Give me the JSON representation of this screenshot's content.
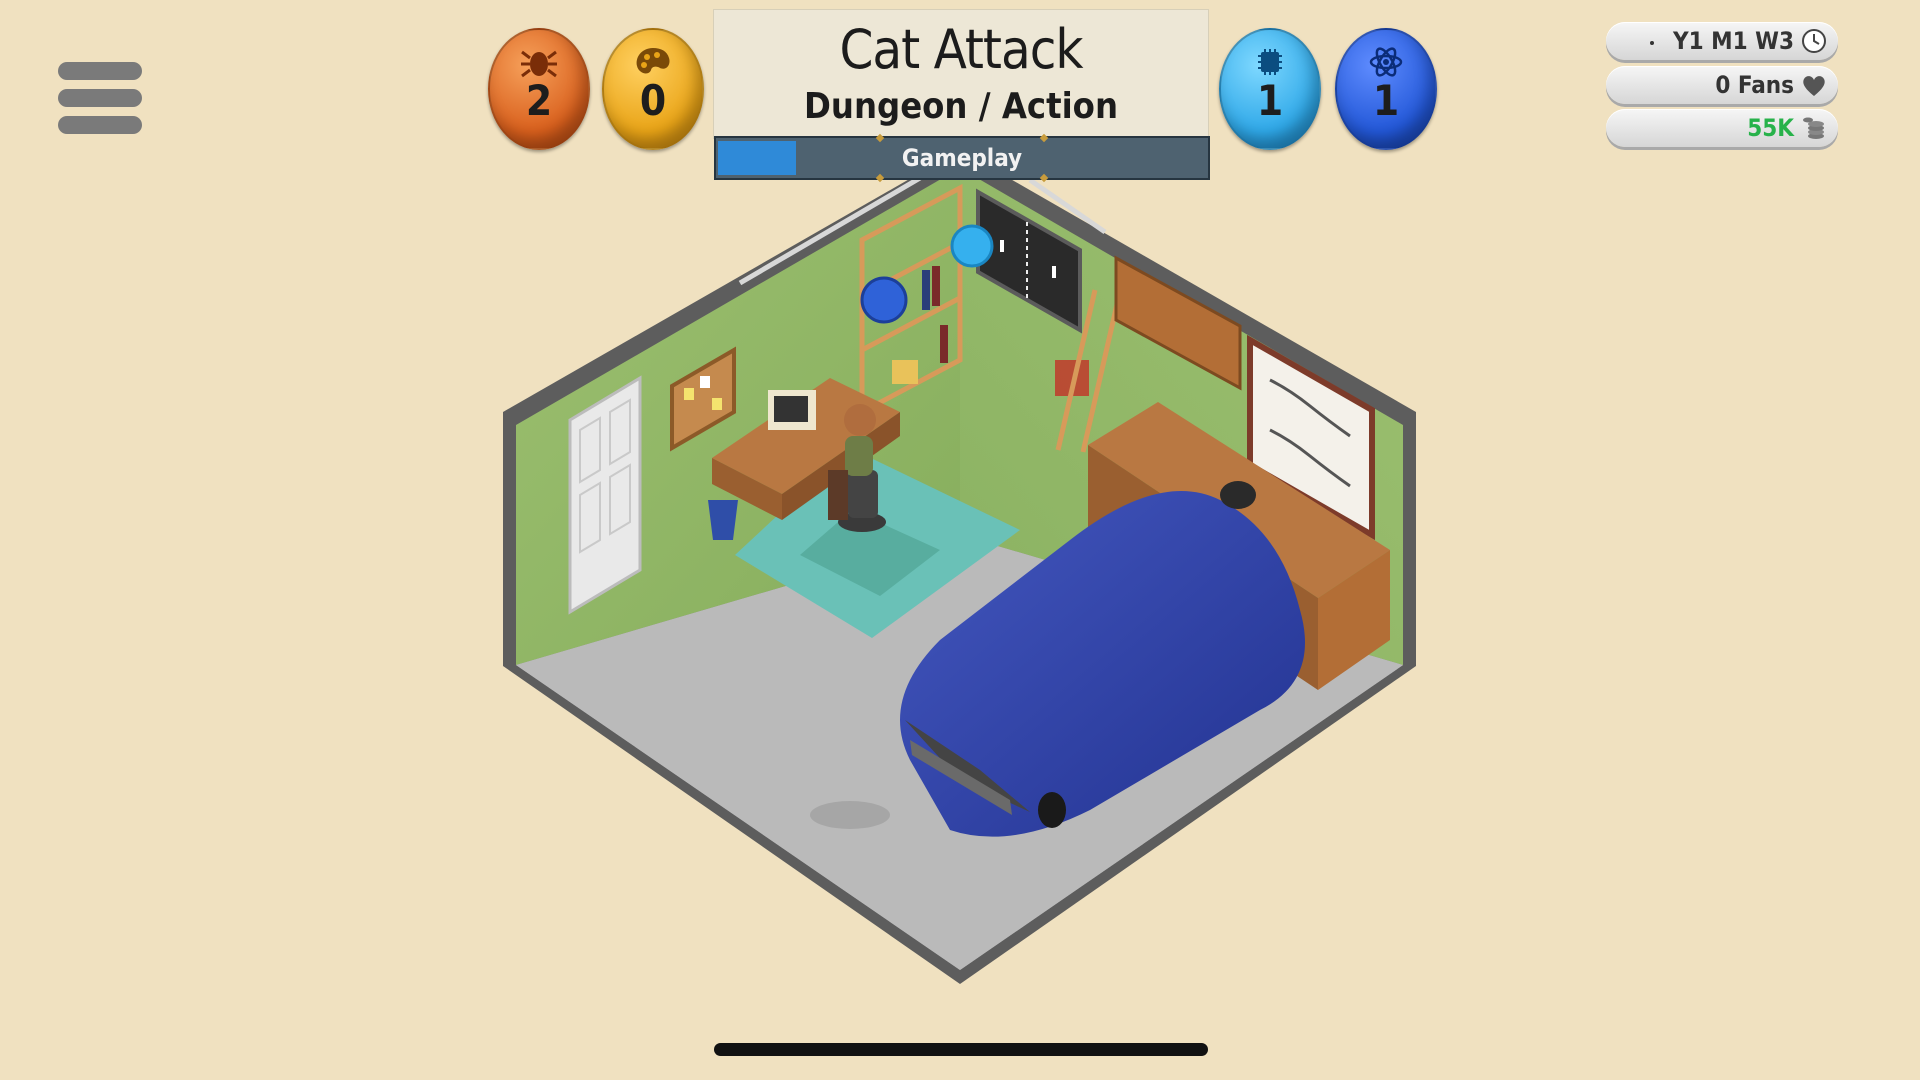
{
  "menu": {
    "icon": "hamburger-menu-icon"
  },
  "points": {
    "bugs": {
      "value": "2",
      "icon": "bug-icon",
      "color": "#d9601d"
    },
    "design": {
      "value": "0",
      "icon": "palette-icon",
      "color": "#e9a417"
    },
    "tech": {
      "value": "1",
      "icon": "chip-icon",
      "color": "#2fa8e8"
    },
    "research": {
      "value": "1",
      "icon": "atom-icon",
      "color": "#2358d8"
    }
  },
  "project": {
    "title": "Cat Attack",
    "genre": "Dungeon / Action",
    "phase": "Gameplay",
    "progress": 0.16
  },
  "status": {
    "date": "Y1 M1 W3",
    "fans": "0 Fans",
    "cash": "55K",
    "date_icon": "clock-icon",
    "fans_icon": "heart-icon",
    "cash_icon": "coins-icon",
    "cash_color": "#27b24a"
  }
}
